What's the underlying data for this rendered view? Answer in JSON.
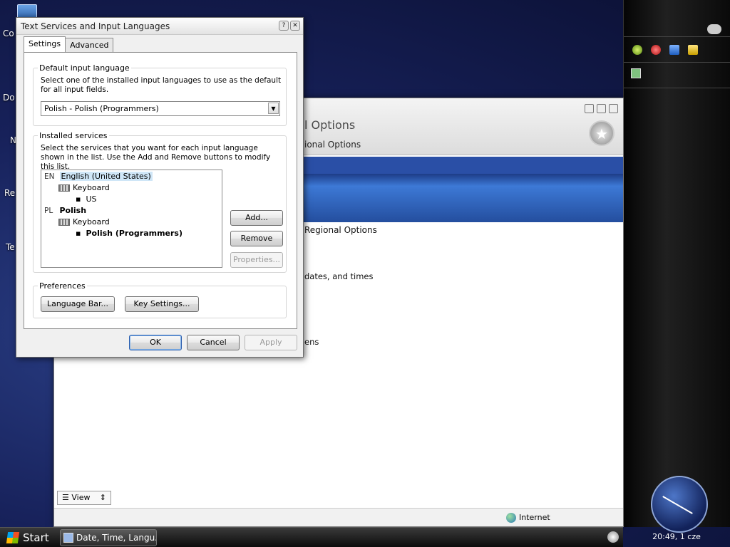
{
  "desktop": {
    "icon_labels": [
      "Co",
      "Do",
      "N",
      "Re",
      "Te"
    ]
  },
  "bg_window": {
    "title": "l Options",
    "subtitle": "ional Options",
    "link_regional": "Regional Options",
    "link_dates": "dates, and times",
    "link_ens": "ens",
    "view_label": "View",
    "status_zone": "Internet"
  },
  "dialog": {
    "title": "Text Services and Input Languages",
    "tabs": [
      {
        "label": "Settings",
        "active": true
      },
      {
        "label": "Advanced",
        "active": false
      }
    ],
    "default_lang": {
      "caption": "Default input language",
      "description": "Select one of the installed input languages to use as the default for all input fields.",
      "selected": "Polish - Polish (Programmers)"
    },
    "installed": {
      "caption": "Installed services",
      "description": "Select the services that you want for each input language shown in the list. Use the Add and Remove buttons to modify this list.",
      "tree": {
        "en_code": "EN",
        "en_name": "English (United States)",
        "en_kb": "Keyboard",
        "en_layout": "US",
        "pl_code": "PL",
        "pl_name": "Polish",
        "pl_kb": "Keyboard",
        "pl_layout": "Polish (Programmers)"
      },
      "add": "Add...",
      "remove": "Remove",
      "properties": "Properties..."
    },
    "preferences": {
      "caption": "Preferences",
      "language_bar": "Language Bar...",
      "key_settings": "Key Settings..."
    },
    "ok": "OK",
    "cancel": "Cancel",
    "apply": "Apply"
  },
  "taskbar": {
    "start": "Start",
    "task_item": "Date, Time, Langu..."
  },
  "sidebar": {
    "clock_text": "20:49, 1 cze"
  },
  "colors": {
    "accent": "#2b5dad",
    "selection": "#cfe6f7",
    "banner": "#3d79d6"
  }
}
